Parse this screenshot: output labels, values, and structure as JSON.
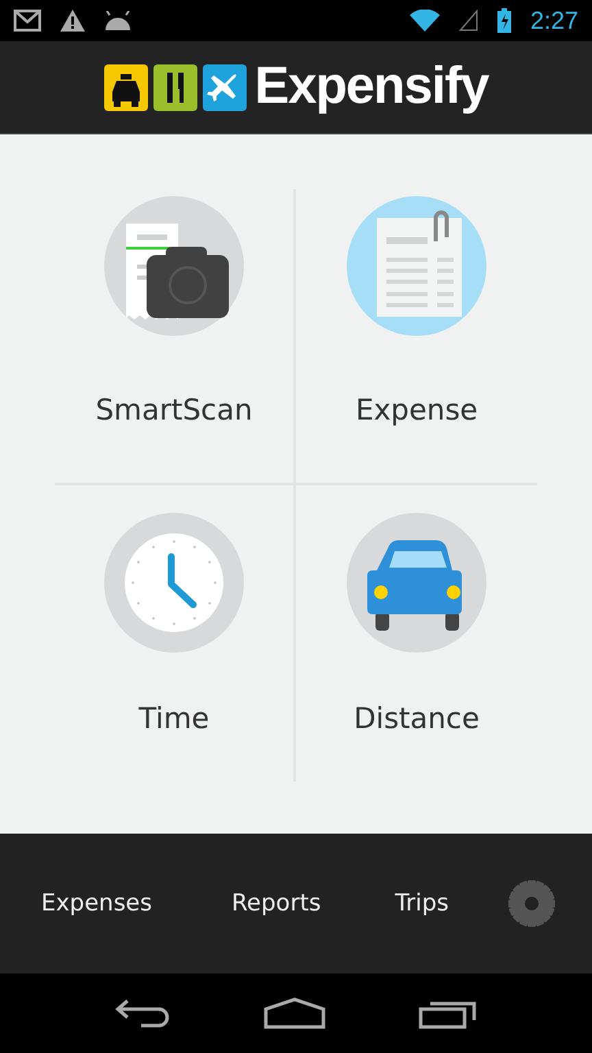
{
  "status_bar": {
    "time": "2:27"
  },
  "header": {
    "logo_text": "Expensify"
  },
  "tiles": [
    {
      "kind": "smartscan",
      "label": "SmartScan"
    },
    {
      "kind": "expense",
      "label": "Expense"
    },
    {
      "kind": "time",
      "label": "Time"
    },
    {
      "kind": "distance",
      "label": "Distance"
    }
  ],
  "tab_bar": {
    "tabs": [
      "Expenses",
      "Reports",
      "Trips"
    ]
  }
}
